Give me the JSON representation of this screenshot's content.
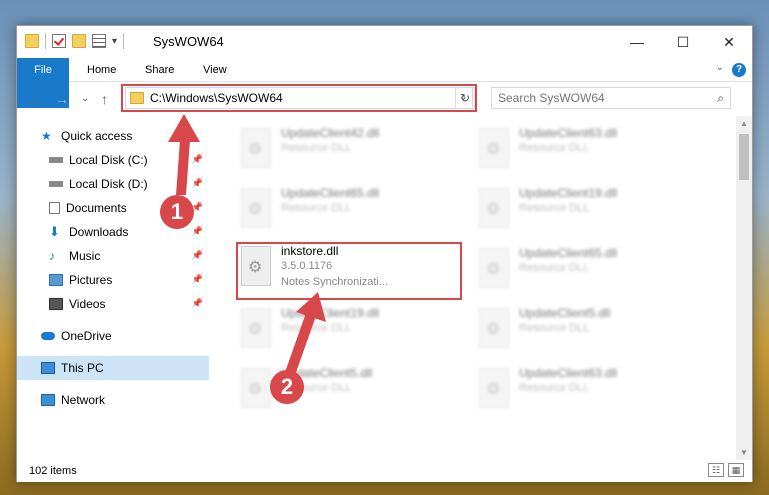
{
  "window": {
    "title": "SysWOW64"
  },
  "titlebar": {
    "qat_dropdown": "▾",
    "minimize": "—",
    "maximize": "☐",
    "close": "✕"
  },
  "ribbon": {
    "tabs": [
      "File",
      "Home",
      "Share",
      "View"
    ],
    "help": "?",
    "expand": "⌄"
  },
  "nav": {
    "back": "←",
    "forward": "→",
    "recent": "⌄",
    "up": "↑"
  },
  "address": {
    "path": "C:\\Windows\\SysWOW64",
    "dropdown": "⌄",
    "refresh": "↻"
  },
  "search": {
    "placeholder": "Search SysWOW64",
    "icon": "⌕"
  },
  "sidebar": {
    "items": [
      {
        "label": "Quick access",
        "icon": "star-icon",
        "pinned": false
      },
      {
        "label": "Local Disk (C:)",
        "icon": "drive-icon",
        "pinned": true
      },
      {
        "label": "Local Disk (D:)",
        "icon": "drive-icon",
        "pinned": true
      },
      {
        "label": "Documents",
        "icon": "documents-icon",
        "pinned": true
      },
      {
        "label": "Downloads",
        "icon": "download-icon",
        "pinned": true
      },
      {
        "label": "Music",
        "icon": "music-icon",
        "pinned": true
      },
      {
        "label": "Pictures",
        "icon": "pictures-icon",
        "pinned": true
      },
      {
        "label": "Videos",
        "icon": "videos-icon",
        "pinned": true
      },
      {
        "label": "OneDrive",
        "icon": "cloud-icon",
        "pinned": false
      },
      {
        "label": "This PC",
        "icon": "pc-icon",
        "pinned": false,
        "selected": true
      },
      {
        "label": "Network",
        "icon": "network-icon",
        "pinned": false
      }
    ],
    "pin_glyph": "📌"
  },
  "files": [
    {
      "name": "UpdateClient42.dll",
      "line2": "Resource DLL",
      "blurred": true
    },
    {
      "name": "UpdateClient63.dll",
      "line2": "Resource DLL",
      "blurred": true
    },
    {
      "name": "UpdateClient65.dll",
      "line2": "Resource DLL",
      "blurred": true
    },
    {
      "name": "UpdateClient19.dll",
      "line2": "Resource DLL",
      "blurred": true
    },
    {
      "name": "inkstore.dll",
      "line2": "3.5.0.1176",
      "line3": "Notes Synchronizati...",
      "blurred": false
    },
    {
      "name": "UpdateClient65.dll",
      "line2": "Resource DLL",
      "blurred": true
    },
    {
      "name": "UpdateClient19.dll",
      "line2": "Resource DLL",
      "blurred": true
    },
    {
      "name": "UpdateClient5.dll",
      "line2": "Resource DLL",
      "blurred": true
    },
    {
      "name": "UpdateClient5.dll",
      "line2": "Resource DLL",
      "blurred": true
    },
    {
      "name": "UpdateClient63.dll",
      "line2": "Resource DLL",
      "blurred": true
    }
  ],
  "status": {
    "count": "102 items",
    "details_view": "☷",
    "icons_view": "▦"
  },
  "annotations": {
    "step1": "1",
    "step2": "2",
    "color": "#d8474a"
  }
}
